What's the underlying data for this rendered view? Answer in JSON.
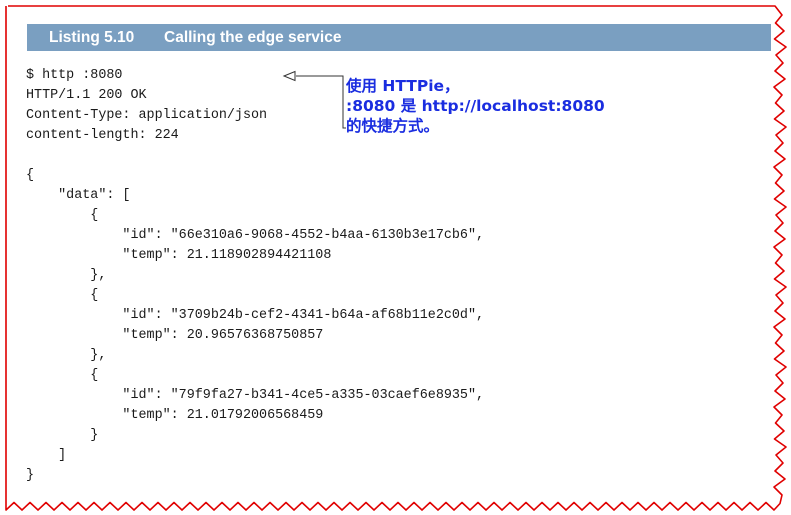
{
  "listing": {
    "number": "Listing 5.10",
    "title": "Calling the edge service"
  },
  "code_lines": [
    "$ http :8080",
    "HTTP/1.1 200 OK",
    "Content-Type: application/json",
    "content-length: 224",
    "",
    "{",
    "    \"data\": [",
    "        {",
    "            \"id\": \"66e310a6-9068-4552-b4aa-6130b3e17cb6\",",
    "            \"temp\": 21.118902894421108",
    "        },",
    "        {",
    "            \"id\": \"3709b24b-cef2-4341-b64a-af68b11e2c0d\",",
    "            \"temp\": 20.96576368750857",
    "        },",
    "        {",
    "            \"id\": \"79f9fa27-b341-4ce5-a335-03caef6e8935\",",
    "            \"temp\": 21.01792006568459",
    "        }",
    "    ]",
    "}"
  ],
  "annotation_lines": [
    "使用 HTTPie，",
    ":8080 是 http://localhost:8080",
    "的快捷方式。"
  ],
  "colors": {
    "header_bg": "#7a9fc1",
    "annotation_text": "#1a2de0",
    "torn_edge": "#e00000"
  }
}
